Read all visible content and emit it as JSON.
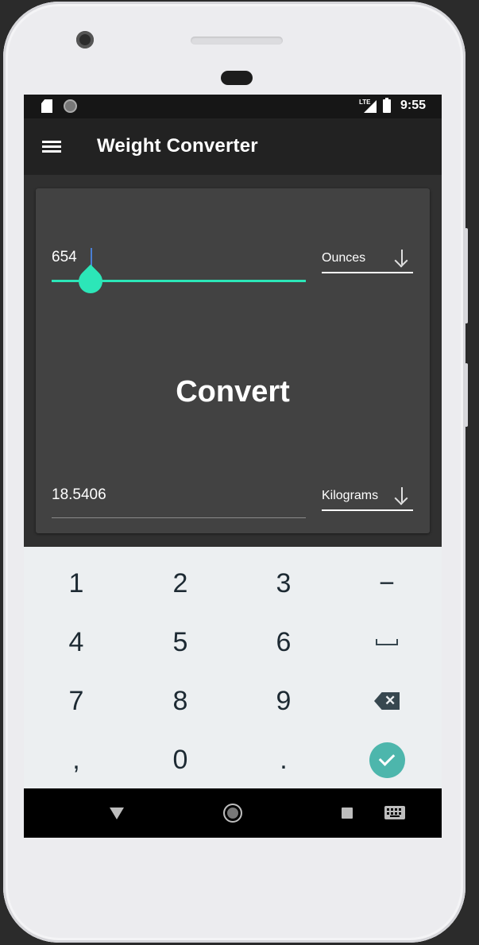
{
  "status_bar": {
    "network": "LTE",
    "time": "9:55"
  },
  "app_bar": {
    "title": "Weight Converter"
  },
  "converter": {
    "input_value": "654",
    "input_unit": "Ounces",
    "convert_label": "Convert",
    "output_value": "18.5406",
    "output_unit": "Kilograms"
  },
  "keyboard": {
    "rows": [
      [
        "1",
        "2",
        "3",
        "−"
      ],
      [
        "4",
        "5",
        "6",
        "space"
      ],
      [
        "7",
        "8",
        "9",
        "backspace"
      ],
      [
        ",",
        "0",
        ".",
        "done"
      ]
    ]
  },
  "colors": {
    "accent": "#2ce6b8",
    "card": "#424242",
    "done_button": "#4db6ac"
  }
}
